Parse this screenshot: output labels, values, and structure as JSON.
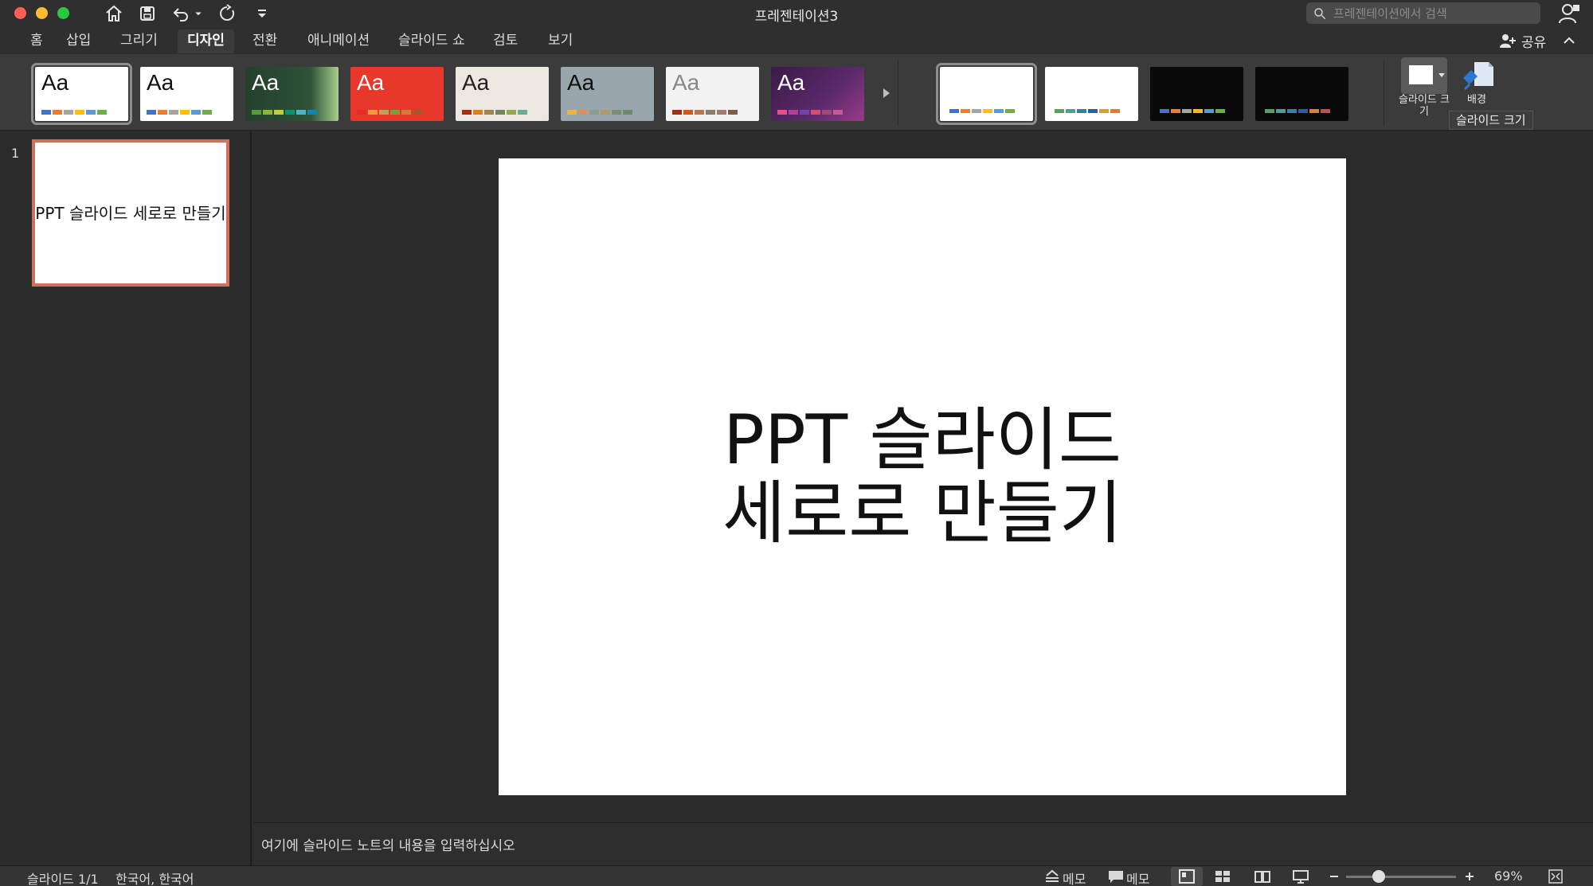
{
  "window": {
    "title": "프레젠테이션3"
  },
  "search": {
    "placeholder": "프레젠테이션에서 검색"
  },
  "tabs": [
    {
      "label": "홈"
    },
    {
      "label": "삽입"
    },
    {
      "label": "그리기"
    },
    {
      "label": "디자인",
      "active": true
    },
    {
      "label": "전환"
    },
    {
      "label": "애니메이션"
    },
    {
      "label": "슬라이드 쇼"
    },
    {
      "label": "검토"
    },
    {
      "label": "보기"
    }
  ],
  "share": {
    "label": "공유"
  },
  "themes": [
    {
      "label": "Aa",
      "bg": "#ffffff",
      "fg": "#111111"
    },
    {
      "label": "Aa",
      "bg": "#ffffff",
      "fg": "#111111"
    },
    {
      "label": "Aa",
      "bg": "#2c4a33",
      "fg": "#ffffff"
    },
    {
      "label": "Aa",
      "bg": "#e8382b",
      "fg": "#ffffff"
    },
    {
      "label": "Aa",
      "bg": "#ece8e0",
      "fg": "#222222"
    },
    {
      "label": "Aa",
      "bg": "#97a7ad",
      "fg": "#111111"
    },
    {
      "label": "Aa",
      "bg": "#f2f2f2",
      "fg": "#888888"
    },
    {
      "label": "Aa",
      "bg": "#4a1f52",
      "fg": "#ffffff"
    }
  ],
  "variants": [
    {
      "bg": "#ffffff"
    },
    {
      "bg": "#ffffff"
    },
    {
      "bg": "#0a0a0a"
    },
    {
      "bg": "#0a0a0a"
    }
  ],
  "ribbon": {
    "slide_size_label": "슬라이드 크기",
    "background_label": "배경",
    "tooltip": "슬라이드 크기"
  },
  "thumbnails": [
    {
      "number": "1",
      "title": "PPT 슬라이드 세로로 만들기"
    }
  ],
  "slide": {
    "title_line1": "PPT 슬라이드",
    "title_line2": "세로로 만들기"
  },
  "notes": {
    "placeholder": "여기에 슬라이드 노트의 내용을 입력하십시오"
  },
  "status": {
    "slide_counter": "슬라이드 1/1",
    "language": "한국어, 한국어",
    "notes_label": "메모",
    "comments_label": "메모",
    "zoom": "69%",
    "zoom_fraction": 0.3
  },
  "colors": {
    "accent": "#d0705c"
  }
}
